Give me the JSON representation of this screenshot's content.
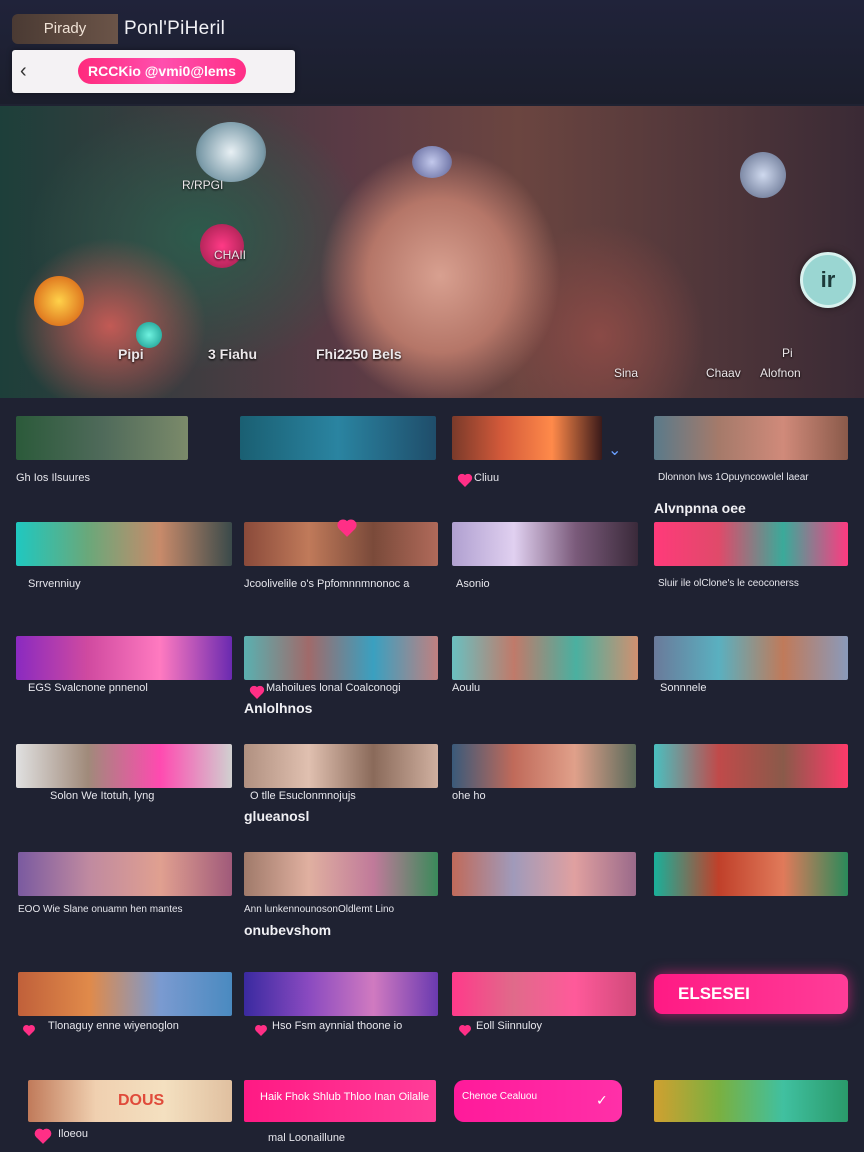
{
  "header": {
    "ready_label": "Pirady",
    "app_title": "Ponl'PiHeril",
    "search_logo_text": "RCCKio @vmi0@lems",
    "back_icon": "chevron-left-icon"
  },
  "hero": {
    "labels": [
      "R/RPGI",
      "CHAII",
      "Pipi",
      "3 Fiahu",
      "Fhi2250 Bels",
      "Pi",
      "Sina",
      "Chaav",
      "Alofnon",
      "ir"
    ]
  },
  "rows": [
    {
      "cards": [
        {
          "caption": "Gh Ios Ilsuures",
          "extra": ""
        },
        {
          "caption": "",
          "extra": ""
        },
        {
          "caption": "Cliuu",
          "extra": ""
        },
        {
          "caption": "Dlonnon lws 1Opuyncowolel laear",
          "extra": "Alvnpnna oee"
        }
      ]
    },
    {
      "cards": [
        {
          "caption": "Srrvenniuy",
          "extra": ""
        },
        {
          "caption": "Jcoolivelile o's Ppfomnnmnonoc a",
          "extra": ""
        },
        {
          "caption": "Asonio",
          "extra": ""
        },
        {
          "caption": "Sluir ile olClone's le ceoconerss",
          "extra": ""
        }
      ]
    },
    {
      "cards": [
        {
          "caption": "EGS Svalcnone pnnenol",
          "extra": ""
        },
        {
          "caption": "Mahoilues lonal Coalconogi",
          "extra": "Anlolhnos"
        },
        {
          "caption": "Aoulu",
          "extra": ""
        },
        {
          "caption": "Sonnnele",
          "extra": ""
        }
      ]
    },
    {
      "cards": [
        {
          "caption": "Solon We Itotuh, lyng",
          "extra": ""
        },
        {
          "caption": "O tlle Esuclonmnojujs",
          "extra": "glueanosl"
        },
        {
          "caption": "ohe ho",
          "extra": ""
        },
        {
          "caption": "",
          "extra": ""
        }
      ]
    },
    {
      "cards": [
        {
          "caption": "EOO Wie Slane onuamn hen mantes",
          "extra": ""
        },
        {
          "caption": "Ann lunkennounosonOldlemt Lino",
          "extra": "onubevshom"
        },
        {
          "caption": "",
          "extra": ""
        },
        {
          "caption": "",
          "extra": ""
        }
      ]
    },
    {
      "cards": [
        {
          "caption": "Tlonaguy enne wiyenoglon",
          "extra": ""
        },
        {
          "caption": "Hso Fsm aynnial thoone io",
          "extra": ""
        },
        {
          "caption": "Eoll Siinnuloy",
          "extra": ""
        },
        {
          "caption": "",
          "extra": "ELSESEI"
        }
      ]
    },
    {
      "cards": [
        {
          "caption": "Iloeou",
          "extra": "DOUS"
        },
        {
          "caption": "mal Loonaillune",
          "extra": "Haik Fhok Shlub Thloo Inan Oilalle"
        },
        {
          "caption": "",
          "extra": "Chenoe Cealuou"
        },
        {
          "caption": "",
          "extra": ""
        }
      ]
    }
  ],
  "colors": {
    "accent": "#ff2f86",
    "background": "#1f2232"
  }
}
